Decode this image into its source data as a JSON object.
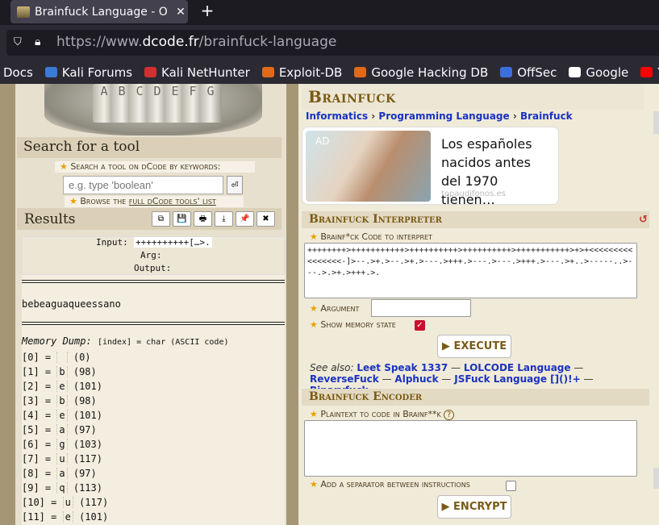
{
  "browser": {
    "tab_title": "Brainfuck Language - O",
    "tab_close": "✕",
    "new_tab": "+",
    "url_prefix": "https://www.",
    "url_domain": "dcode.fr",
    "url_path": "/brainfuck-language",
    "bookmarks": [
      {
        "label": "Docs",
        "color": ""
      },
      {
        "label": "Kali Forums",
        "color": "#3a7bd5"
      },
      {
        "label": "Kali NetHunter",
        "color": "#d03030"
      },
      {
        "label": "Exploit-DB",
        "color": "#e06a1a"
      },
      {
        "label": "Google Hacking DB",
        "color": "#e06a1a"
      },
      {
        "label": "OffSec",
        "color": "#3b6fe0"
      },
      {
        "label": "Google",
        "color": "#ffffff"
      },
      {
        "label": "YouTube",
        "color": "#ff0000"
      }
    ]
  },
  "sidebar": {
    "lock_letters": [
      "A",
      "B",
      "C",
      "D",
      "E",
      "F",
      "G"
    ],
    "search_heading": "Search for a tool",
    "search_label": "Search a tool on dCode by keywords:",
    "search_placeholder": "e.g. type 'boolean'",
    "search_button": "⏎",
    "browse_prefix": "Browse the ",
    "browse_link": "full dCode tools' list",
    "results_heading": "Results",
    "result_buttons": [
      "⧉",
      "💾",
      "🖶",
      "⤓",
      "📌",
      "✖"
    ]
  },
  "results": {
    "input_label": "Input:",
    "input_value": "++++++++++[…>.",
    "arg_label": "Arg:",
    "output_label": "Output:",
    "output_text": "bebeaguaqueessano",
    "memory_label": "Memory Dump:",
    "memory_legend": "[index] = char (ASCII code)",
    "memory_rows": [
      {
        "index": "[0]",
        "char": " ",
        "code": "(0)"
      },
      {
        "index": "[1]",
        "char": "b",
        "code": "(98)"
      },
      {
        "index": "[2]",
        "char": "e",
        "code": "(101)"
      },
      {
        "index": "[3]",
        "char": "b",
        "code": "(98)"
      },
      {
        "index": "[4]",
        "char": "e",
        "code": "(101)"
      },
      {
        "index": "[5]",
        "char": "a",
        "code": "(97)"
      },
      {
        "index": "[6]",
        "char": "g",
        "code": "(103)"
      },
      {
        "index": "[7]",
        "char": "u",
        "code": "(117)"
      },
      {
        "index": "[8]",
        "char": "a",
        "code": "(97)"
      },
      {
        "index": "[9]",
        "char": "q",
        "code": "(113)"
      },
      {
        "index": "[10]",
        "char": "u",
        "code": "(117)"
      },
      {
        "index": "[11]",
        "char": "e",
        "code": "(101)"
      }
    ]
  },
  "main": {
    "title": "Brainfuck",
    "breadcrumbs": [
      "Informatics",
      "Programming Language",
      "Brainfuck"
    ],
    "ad": {
      "tag": "AD",
      "text": "Los españoles nacidos antes del 1970 tienen…",
      "source": "topaudifonos.es"
    },
    "interpreter": {
      "heading": "Brainfuck Interpreter",
      "refresh": "↺",
      "code_label": "Brainf*ck Code to interpret",
      "code_value": "++++++++>+++++++++++>++++++++++>++++++++++>+++++++++++>+>+<<<<<<<<<<<<<<<<-]>--.>+.>--.>+.>---.>+++.>---.>---.>+++.>---.>+..>-----..>---.>.>+.>+++.>.",
      "arg_label": "Argument",
      "memory_label": "Show memory state",
      "memory_checked": "✓",
      "execute_label": "▶ EXECUTE",
      "see_also_label": "See also:",
      "see_also": [
        "Leet Speak 1337",
        "LOLCODE Language",
        "ReverseFuck",
        "Alphuck",
        "JSFuck Language []()!+",
        "Binaryfuck"
      ]
    },
    "encoder": {
      "heading": "Brainfuck Encoder",
      "plain_label": "Plaintext to code in Brainf**k",
      "help": "?",
      "separator_label": "Add a separator between instructions",
      "encrypt_label": "▶ ENCRYPT"
    }
  },
  "colors": {
    "accent_gold": "#7a5a14",
    "link_blue": "#1a33c2",
    "star": "#e8a000"
  }
}
